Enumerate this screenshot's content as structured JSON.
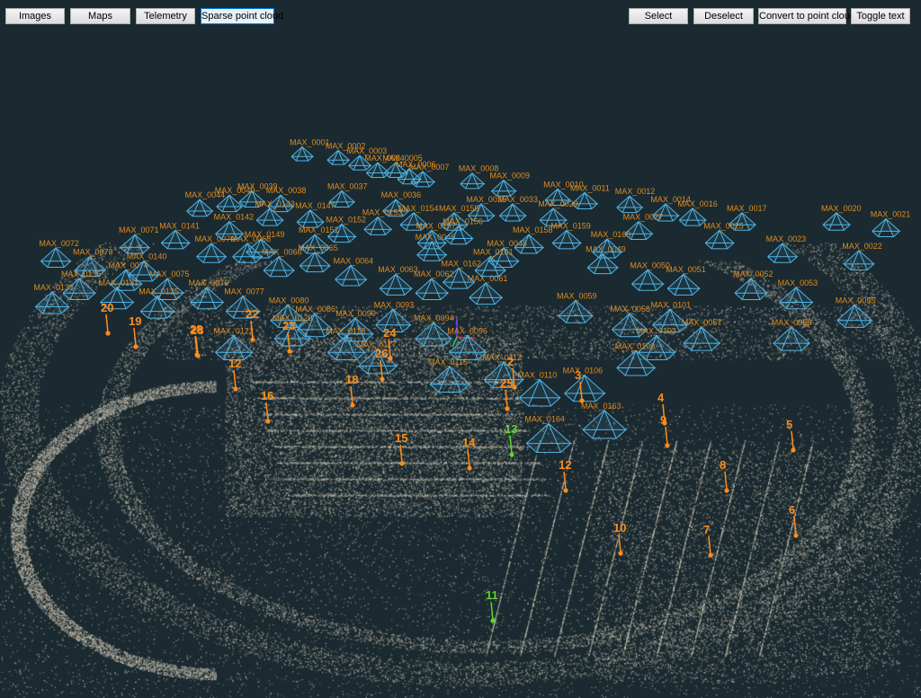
{
  "toolbar": {
    "images": "Images",
    "maps": "Maps",
    "telemetry": "Telemetry",
    "sparse": "Sparse point cloud",
    "select": "Select",
    "deselect": "Deselect",
    "convert": "Convert to point cloud",
    "toggle": "Toggle text"
  },
  "colors": {
    "background": "#1b2a30",
    "camera": "#4fb4e6",
    "camera_label": "#e08a1e",
    "gcp_orange": "#ff8c1a",
    "gcp_green": "#5ed62e",
    "point": "#cfc3b0"
  },
  "cameras": [
    "MAX_0001",
    "MAX_0002",
    "MAX_0003",
    "MAX_0004",
    "MAX_0005",
    "MAX_0006",
    "MAX_0007",
    "MAX_0008",
    "MAX_0009",
    "MAX_0010",
    "MAX_0011",
    "MAX_0012",
    "MAX_0014",
    "MAX_0016",
    "MAX_0017",
    "MAX_0020",
    "MAX_0021",
    "MAX_0022",
    "MAX_0023",
    "MAX_0025",
    "MAX_0027",
    "MAX_0029",
    "MAX_0033",
    "MAX_0035",
    "MAX_0036",
    "MAX_0037",
    "MAX_0038",
    "MAX_0039",
    "MAX_0040",
    "MAX_0044",
    "MAX_0046",
    "MAX_0048",
    "MAX_0049",
    "MAX_0050",
    "MAX_0051",
    "MAX_0052",
    "MAX_0053",
    "MAX_0055",
    "MAX_0056",
    "MAX_0057",
    "MAX_0058",
    "MAX_0059",
    "MAX_0061",
    "MAX_0062",
    "MAX_0063",
    "MAX_0064",
    "MAX_0065",
    "MAX_0066",
    "MAX_0068",
    "MAX_0070",
    "MAX_0071",
    "MAX_0072",
    "MAX_0073",
    "MAX_0074",
    "MAX_0075",
    "MAX_0076",
    "MAX_0077",
    "MAX_0080",
    "MAX_0086",
    "MAX_0090",
    "MAX_0093",
    "MAX_0094",
    "MAX_0096",
    "MAX_0101",
    "MAX_0102",
    "MAX_0103",
    "MAX_0106",
    "MAX_0110",
    "MAX_0112",
    "MAX_0115",
    "MAX_0117",
    "MAX_0118",
    "MAX_0120",
    "MAX_0122",
    "MAX_0125",
    "MAX_0131",
    "MAX_0133",
    "MAX_0135",
    "MAX_0140",
    "MAX_0141",
    "MAX_0142",
    "MAX_0143",
    "MAX_0147",
    "MAX_0149",
    "MAX_0151",
    "MAX_0152",
    "MAX_0153",
    "MAX_0154",
    "MAX_0155",
    "MAX_0156",
    "MAX_0157",
    "MAX_0158",
    "MAX_0159",
    "MAX_0160",
    "MAX_0161",
    "MAX_0162",
    "MAX_0163",
    "MAX_0164"
  ],
  "gcps": [
    {
      "label": "2",
      "color": "orange"
    },
    {
      "label": "3",
      "color": "orange"
    },
    {
      "label": "4",
      "color": "orange"
    },
    {
      "label": "5",
      "color": "orange"
    },
    {
      "label": "6",
      "color": "orange"
    },
    {
      "label": "7",
      "color": "orange"
    },
    {
      "label": "8",
      "color": "orange"
    },
    {
      "label": "9",
      "color": "orange"
    },
    {
      "label": "10",
      "color": "orange"
    },
    {
      "label": "11",
      "color": "green"
    },
    {
      "label": "12",
      "color": "orange"
    },
    {
      "label": "12",
      "color": "orange"
    },
    {
      "label": "13",
      "color": "green"
    },
    {
      "label": "14",
      "color": "orange"
    },
    {
      "label": "15",
      "color": "orange"
    },
    {
      "label": "16",
      "color": "orange"
    },
    {
      "label": "18",
      "color": "orange"
    },
    {
      "label": "19",
      "color": "orange"
    },
    {
      "label": "20",
      "color": "orange"
    },
    {
      "label": "22",
      "color": "orange"
    },
    {
      "label": "23",
      "color": "orange"
    },
    {
      "label": "24",
      "color": "orange"
    },
    {
      "label": "25",
      "color": "orange"
    },
    {
      "label": "26",
      "color": "orange"
    },
    {
      "label": "28",
      "color": "orange"
    },
    {
      "label": "28",
      "color": "orange"
    }
  ]
}
